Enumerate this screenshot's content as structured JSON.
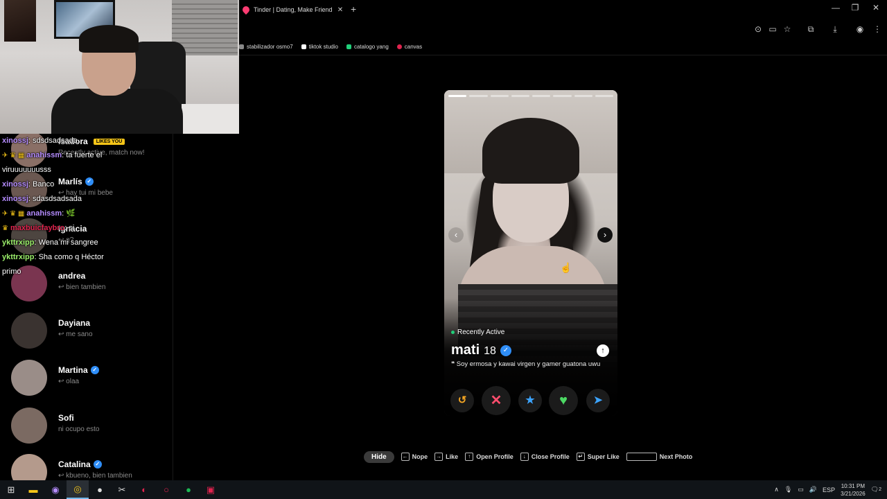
{
  "browser": {
    "tab_title": "Tinder | Dating, Make Friends &",
    "tab_close": "✕",
    "new_tab": "+",
    "bookmarks": [
      {
        "label": "stabilizador osmo7",
        "color": "#888"
      },
      {
        "label": "tiktok studio",
        "color": "#fff"
      },
      {
        "label": "catalogo yang",
        "color": "#21d07a"
      },
      {
        "label": "canvas",
        "color": "#e0234e"
      }
    ]
  },
  "matches": [
    {
      "name": "Isadora",
      "msg": "Recently active, match now!",
      "likes_badge": "LIKES YOU",
      "verified": false,
      "color": "#8a6f66"
    },
    {
      "name": "Marlís",
      "msg": "↩ hay tui mi bebe",
      "verified": true,
      "color": "#6b5851"
    },
    {
      "name": "Ignacia",
      "msg": "↩ q?",
      "verified": false,
      "color": "#4d4540"
    },
    {
      "name": "andrea",
      "msg": "↩ bien tambien",
      "verified": false,
      "color": "#7a3550"
    },
    {
      "name": "Dayiana",
      "msg": "↩ me sano",
      "verified": false,
      "color": "#3a3330"
    },
    {
      "name": "Martina",
      "msg": "↩ olaa",
      "verified": true,
      "color": "#9a8d88"
    },
    {
      "name": "Sofi",
      "msg": "ni ocupo esto",
      "verified": false,
      "color": "#7b6a62"
    },
    {
      "name": "Catalina",
      "msg": "↩ kbueno, bien tambien",
      "verified": true,
      "color": "#b49a8c"
    }
  ],
  "chat": {
    "l1_user": "xinossj",
    "l1_text": ": sdsdsadsada",
    "l2_badges": "✈ ♛ ▦",
    "l2_user": "anahissm",
    "l2_text": ": ta fuerte el",
    "l3_text": "viruuuuuuusss",
    "l4_user": "xinossj",
    "l4_text": ": Banco",
    "l5_user": "xinossj",
    "l5_text": ": sdasdsadsada",
    "l6_badges": "✈ ♛ ▦",
    "l6_user": "anahissm",
    "l6_text": ": 🌿",
    "l7_badges": "♛",
    "l7_user": "maxbuicfaybro",
    "l7_text": ": si",
    "l8_user": "ykttrxipp",
    "l8_text": ": Wena mi sangree",
    "l9_user": "ykttrxipp",
    "l9_text": ": Sha como q Héctor",
    "l10_text": "primo"
  },
  "profile": {
    "status": "Recently Active",
    "name": "mati",
    "age": "18",
    "bio": "❝ Soy ermosa y kawai virgen y gamer guatona uwu",
    "photo_count": 8,
    "active_photo": 1,
    "prev_icon": "‹",
    "next_icon": "›",
    "expand_icon": "↑"
  },
  "actions": {
    "rewind": "↺",
    "nope": "✕",
    "super_like": "★",
    "like": "♥",
    "boost": "➤"
  },
  "hints": {
    "hide": "Hide",
    "nope": "Nope",
    "like": "Like",
    "open_profile": "Open Profile",
    "close_profile": "Close Profile",
    "super_like": "Super Like",
    "next_photo": "Next Photo"
  },
  "tray": {
    "lang": "ESP",
    "time": "10:31 PM",
    "date": "3/21/2026",
    "notif_count": "2"
  }
}
